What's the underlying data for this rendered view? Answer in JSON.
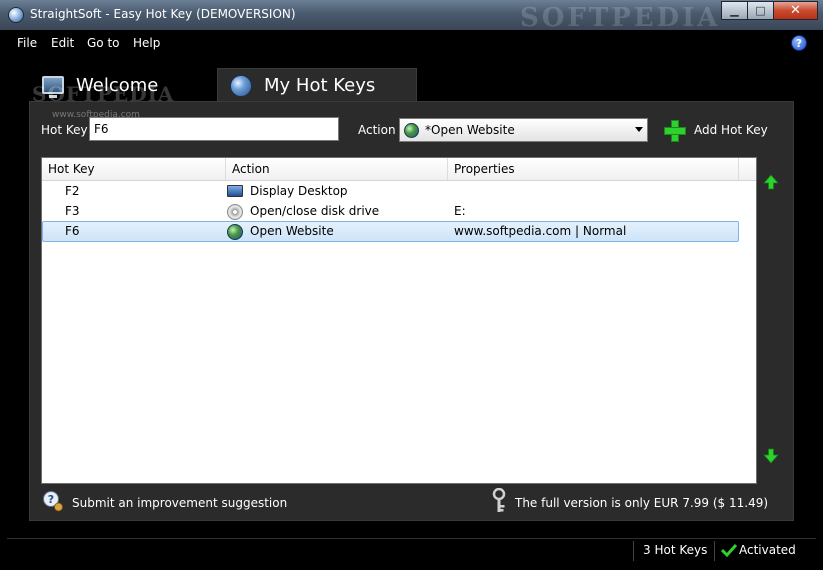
{
  "window": {
    "title": "StraightSoft - Easy Hot Key (DEMOVERSION)",
    "watermark": "SOFTPEDIA",
    "controls": {
      "minimize": "▁",
      "maximize": "□",
      "close": "✕"
    }
  },
  "menu": {
    "items": [
      "File",
      "Edit",
      "Go to",
      "Help"
    ],
    "help_icon": "?"
  },
  "tabs": [
    {
      "label": "Welcome",
      "icon": "monitor-icon"
    },
    {
      "label": "My Hot Keys",
      "icon": "globe-icon"
    }
  ],
  "watermark": {
    "brand": "SOFTPEDIA",
    "url": "www.softpedia.com"
  },
  "form": {
    "hotkey_label": "Hot Key",
    "hotkey_value": "F6",
    "action_label": "Action",
    "action_selected": "*Open Website",
    "add_label": "Add Hot Key"
  },
  "table": {
    "columns": [
      "Hot Key",
      "Action",
      "Properties"
    ],
    "rows": [
      {
        "hotkey": "F2",
        "action": "Display Desktop",
        "properties": "",
        "icon": "desktop-icon"
      },
      {
        "hotkey": "F3",
        "action": "Open/close disk drive",
        "properties": "E:",
        "icon": "disk-icon"
      },
      {
        "hotkey": "F6",
        "action": "Open Website",
        "properties": "www.softpedia.com | Normal",
        "icon": "globe-icon",
        "selected": true
      }
    ]
  },
  "footer": {
    "suggestion": "Submit an improvement suggestion",
    "price": "The full version is only EUR 7.99 ($ 11.49)"
  },
  "status": {
    "count": "3 Hot Keys",
    "activation": "Activated"
  },
  "colors": {
    "accent_green": "#2fd12f",
    "selection": "#cde4f8",
    "panel": "#2b2b2b"
  }
}
